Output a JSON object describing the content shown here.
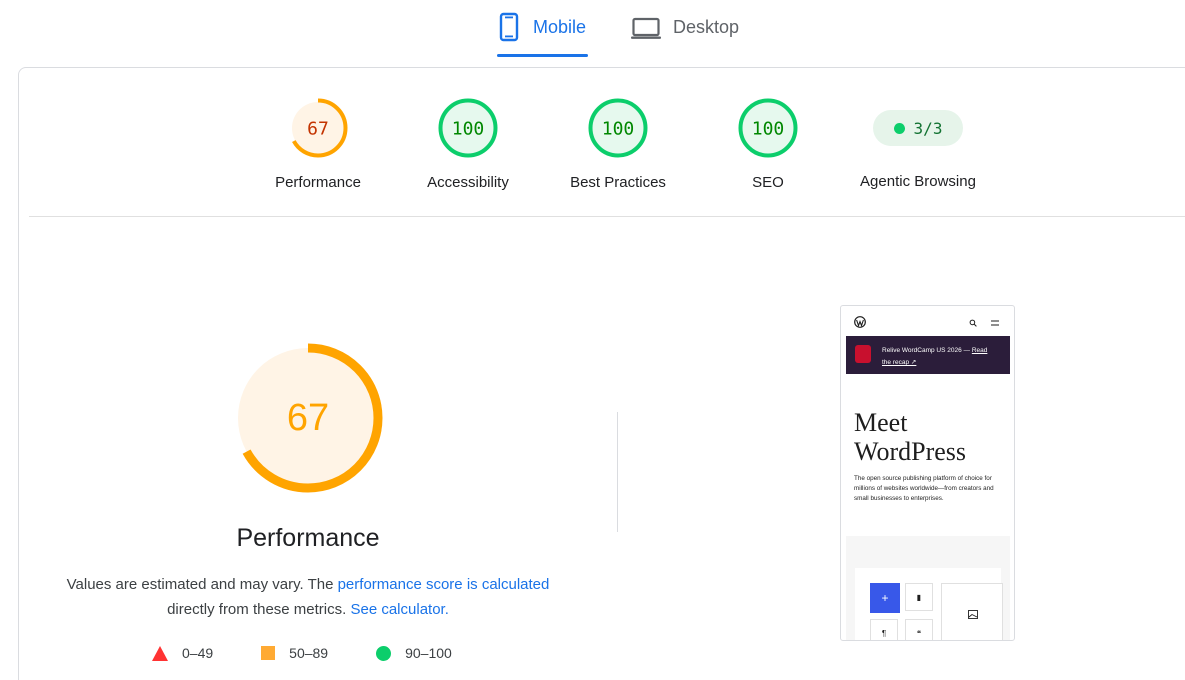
{
  "tabs": {
    "mobile_label": "Mobile",
    "desktop_label": "Desktop",
    "active": "Mobile"
  },
  "scores": {
    "performance": {
      "label": "Performance",
      "value": "67",
      "fraction": 0.67,
      "color": "#ffa400",
      "fill": "#fff4e6",
      "text_color": "#c33300"
    },
    "accessibility": {
      "label": "Accessibility",
      "value": "100",
      "fraction": 1.0,
      "color": "#0cce6b",
      "fill": "#e6f9ee",
      "text_color": "#008800"
    },
    "best_practices": {
      "label": "Best Practices",
      "value": "100",
      "fraction": 1.0,
      "color": "#0cce6b",
      "fill": "#e6f9ee",
      "text_color": "#008800"
    },
    "seo": {
      "label": "SEO",
      "value": "100",
      "fraction": 1.0,
      "color": "#0cce6b",
      "fill": "#e6f9ee",
      "text_color": "#008800"
    },
    "agentic": {
      "label": "Agentic Browsing",
      "value": "3/3"
    }
  },
  "performance_section": {
    "score": "67",
    "title": "Performance",
    "desc_text_1": "Values are estimated and may vary. The ",
    "desc_link_1": "performance score is calculated",
    "desc_text_2": "directly from these metrics. ",
    "desc_link_2": "See calculator."
  },
  "legend": {
    "fail": "0–49",
    "average": "50–89",
    "pass": "90–100"
  },
  "screenshot": {
    "banner_text": "Relive WordCamp US 2026 — ",
    "banner_link_1": "Read",
    "banner_link_2": "the recap ↗",
    "hero": "Meet WordPress",
    "subtitle": "The open source publishing platform of choice for millions of websites worldwide—from creators and small businesses to enterprises."
  },
  "colors": {
    "accent": "#1a73e8",
    "fail": "#ff3333",
    "average": "#ffaa33",
    "pass": "#0cce6b"
  }
}
